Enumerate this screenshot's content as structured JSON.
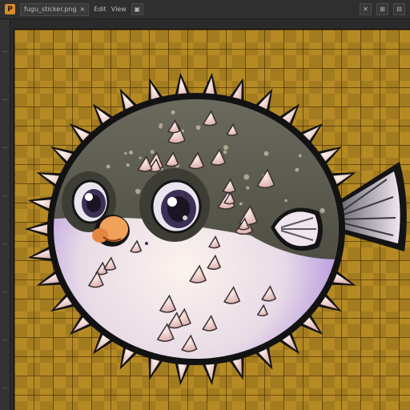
{
  "app": {
    "icon_letter": "P"
  },
  "toolbar": {
    "doc_tab_label": "fugu_sticker.png",
    "doc_close": "×",
    "menu_a": "Edit",
    "menu_b": "View",
    "btn_1": "▣",
    "btn_2": "✕",
    "btn_3": "⊞",
    "btn_4": "⊟"
  },
  "colors": {
    "artboard": "#b58a24",
    "fish_top": "#5f5e52",
    "fish_belly": "#f2e6e4",
    "spike": "#e8c6bf",
    "outline": "#121212"
  },
  "artwork": {
    "subject": "pufferfish-sticker"
  }
}
